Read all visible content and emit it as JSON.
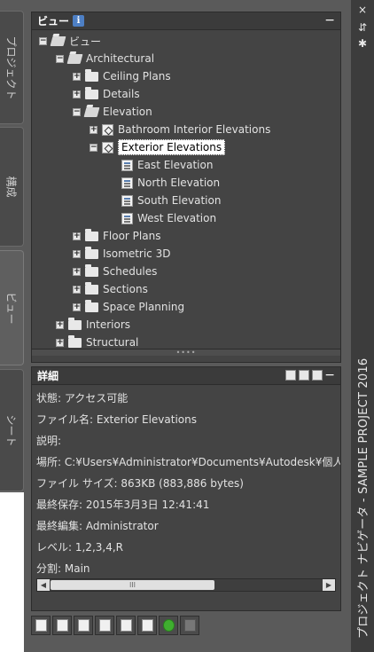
{
  "tabs": [
    {
      "label": "プロジェクト"
    },
    {
      "label": "構成"
    },
    {
      "label": "ビュー"
    },
    {
      "label": "シート"
    }
  ],
  "titlebar": {
    "title": "プロジェクト ナビゲータ - SAMPLE PROJECT 2016",
    "close": "×",
    "autohide": "⇵",
    "properties": "✱"
  },
  "views_panel": {
    "title": "ビュー",
    "info": "i",
    "collapse": "−",
    "tree": [
      {
        "label": "ビュー"
      },
      {
        "label": "Architectural"
      },
      {
        "label": "Ceiling Plans"
      },
      {
        "label": "Details"
      },
      {
        "label": "Elevation"
      },
      {
        "label": "Bathroom Interior Elevations"
      },
      {
        "label": "Exterior Elevations"
      },
      {
        "label": "East Elevation"
      },
      {
        "label": "North Elevation"
      },
      {
        "label": "South Elevation"
      },
      {
        "label": "West Elevation"
      },
      {
        "label": "Floor Plans"
      },
      {
        "label": "Isometric 3D"
      },
      {
        "label": "Schedules"
      },
      {
        "label": "Sections"
      },
      {
        "label": "Space Planning"
      },
      {
        "label": "Interiors"
      },
      {
        "label": "Structural"
      }
    ]
  },
  "details_panel": {
    "title": "詳細",
    "collapse": "−",
    "rows": [
      {
        "text": "状態: アクセス可能"
      },
      {
        "text": "ファイル名: Exterior Elevations"
      },
      {
        "text": "説明:"
      },
      {
        "text": "場所: C:¥Users¥Administrator¥Documents¥Autodesk¥個人用"
      },
      {
        "text": "ファイル サイズ: 863KB (883,886 bytes)"
      },
      {
        "text": "最終保存: 2015年3月3日  12:41:41"
      },
      {
        "text": "最終編集: Administrator"
      },
      {
        "text": "レベル: 1,2,3,4,R"
      },
      {
        "text": "分割: Main"
      }
    ],
    "scroll_left": "◀",
    "scroll_right": "▶",
    "scroll_grip": "III"
  }
}
